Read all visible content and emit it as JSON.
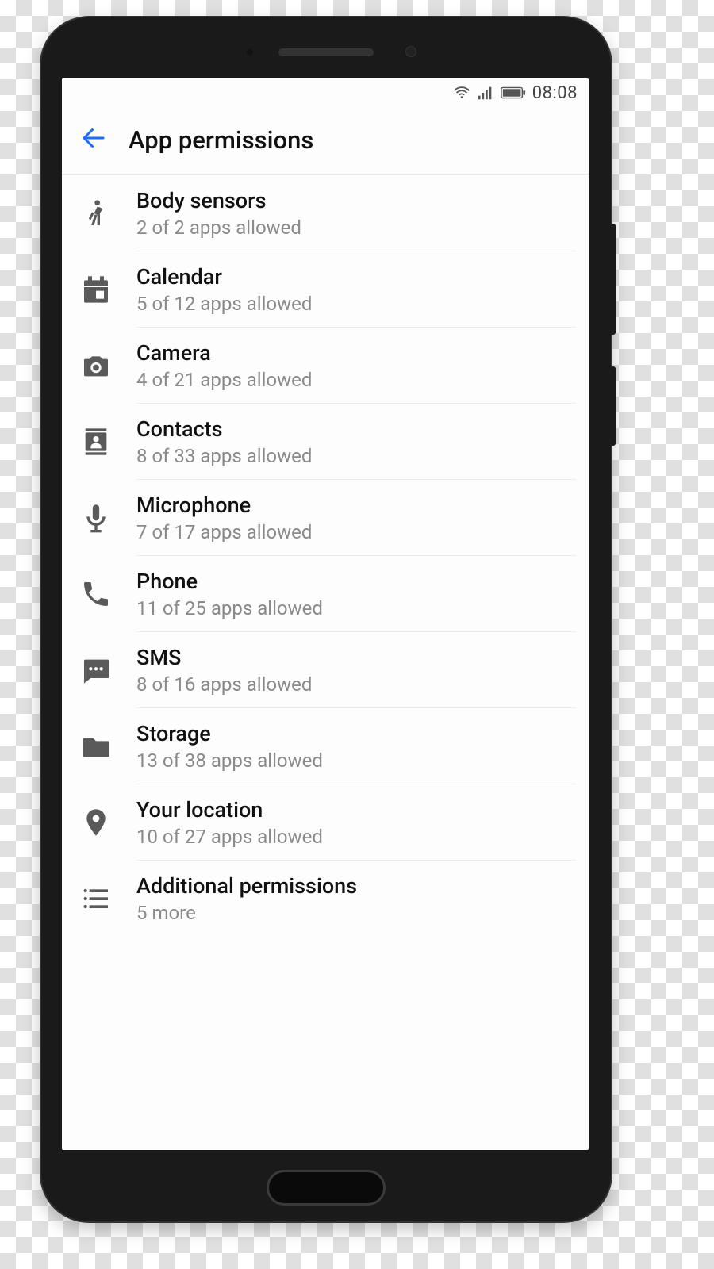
{
  "status": {
    "time": "08:08"
  },
  "header": {
    "title": "App permissions"
  },
  "items": [
    {
      "title": "Body sensors",
      "sub": "2 of 2 apps allowed"
    },
    {
      "title": "Calendar",
      "sub": "5 of 12 apps allowed"
    },
    {
      "title": "Camera",
      "sub": "4 of 21 apps allowed"
    },
    {
      "title": "Contacts",
      "sub": "8 of 33 apps allowed"
    },
    {
      "title": "Microphone",
      "sub": "7 of 17 apps allowed"
    },
    {
      "title": "Phone",
      "sub": "11 of 25 apps allowed"
    },
    {
      "title": "SMS",
      "sub": "8 of 16 apps allowed"
    },
    {
      "title": "Storage",
      "sub": "13 of 38 apps allowed"
    },
    {
      "title": "Your location",
      "sub": "10 of 27 apps allowed"
    },
    {
      "title": "Additional permissions",
      "sub": "5 more"
    }
  ]
}
